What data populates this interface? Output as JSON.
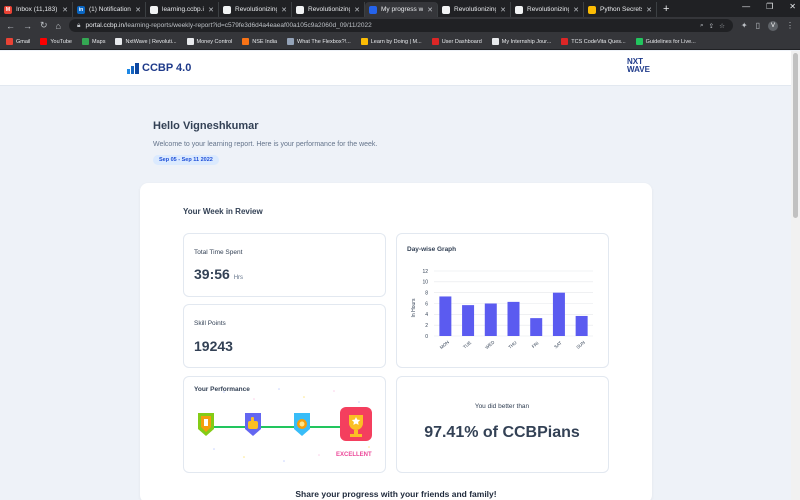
{
  "browser": {
    "tabs": [
      {
        "title": "Inbox (11,183)",
        "color": "#ea4335",
        "glyph": "M",
        "active": false
      },
      {
        "title": "(1) Notification",
        "color": "#0a66c2",
        "glyph": "in",
        "active": false
      },
      {
        "title": "learning.ccbp.in",
        "color": "#f1f3f4",
        "glyph": "",
        "active": false
      },
      {
        "title": "Revolutionizing",
        "color": "#f1f3f4",
        "glyph": "",
        "active": false
      },
      {
        "title": "Revolutionizing",
        "color": "#f1f3f4",
        "glyph": "",
        "active": false
      },
      {
        "title": "My progress w",
        "color": "#2563eb",
        "glyph": "",
        "active": true
      },
      {
        "title": "Revolutionizing",
        "color": "#f1f3f4",
        "glyph": "",
        "active": false
      },
      {
        "title": "Revolutionizing",
        "color": "#f1f3f4",
        "glyph": "",
        "active": false
      },
      {
        "title": "Python Secrets",
        "color": "#fbbc04",
        "glyph": "",
        "active": false
      }
    ],
    "url_host": "portal.ccbp.in",
    "url_path": "/learning-reports/weekly-report?id=c579fe3d6d4a4eaeaf00a105c9a2060d_09/11/2022",
    "bookmarks": [
      {
        "label": "Gmail",
        "color": "#ea4335"
      },
      {
        "label": "YouTube",
        "color": "#ff0000"
      },
      {
        "label": "Maps",
        "color": "#34a853"
      },
      {
        "label": "NxtWave | Revoluti...",
        "color": "#e8eaed"
      },
      {
        "label": "Money Control",
        "color": "#e8eaed"
      },
      {
        "label": "NSE India",
        "color": "#f97316"
      },
      {
        "label": "What The Flexbox?!...",
        "color": "#94a3b8"
      },
      {
        "label": "Learn by Doing | M...",
        "color": "#fbbc04"
      },
      {
        "label": "User Dashboard",
        "color": "#dc2626"
      },
      {
        "label": "My Internship Jour...",
        "color": "#e8eaed"
      },
      {
        "label": "TCS CodeVita Ques...",
        "color": "#dc2626"
      },
      {
        "label": "Guidelines for Live...",
        "color": "#22c55e"
      }
    ]
  },
  "header": {
    "logo_text": "CCBP 4.0",
    "partner_logo_line1": "NXT",
    "partner_logo_line2": "WAVE"
  },
  "intro": {
    "greeting": "Hello Vigneshkumar",
    "welcome": "Welcome to your learning report. Here is your performance for the week.",
    "date_range": "Sep 05 - Sep 11 2022"
  },
  "review": {
    "title": "Your Week in Review",
    "time_label": "Total Time Spent",
    "time_value": "39:56",
    "time_unit": "Hrs",
    "skill_label": "Skill Points",
    "skill_value": "19243",
    "performance_label": "Your Performance",
    "performance_level": "EXCELLENT",
    "performance_levels_count": 4,
    "better_than": "You did better than",
    "percentile": "97.41% of CCBPians",
    "share": "Share your progress with your friends and family!"
  },
  "chart_data": {
    "type": "bar",
    "title": "Day-wise Graph",
    "ylabel": "In Hours",
    "xlabel": "",
    "categories": [
      "MON",
      "TUE",
      "WED",
      "THU",
      "FRI",
      "SAT",
      "SUN"
    ],
    "values": [
      7.3,
      5.7,
      6.0,
      6.3,
      3.3,
      8.0,
      3.7
    ],
    "ylim": [
      0,
      12
    ],
    "yticks": [
      0,
      2,
      4,
      6,
      8,
      10,
      12
    ],
    "bar_color": "#5b5bf0",
    "grid": true
  }
}
